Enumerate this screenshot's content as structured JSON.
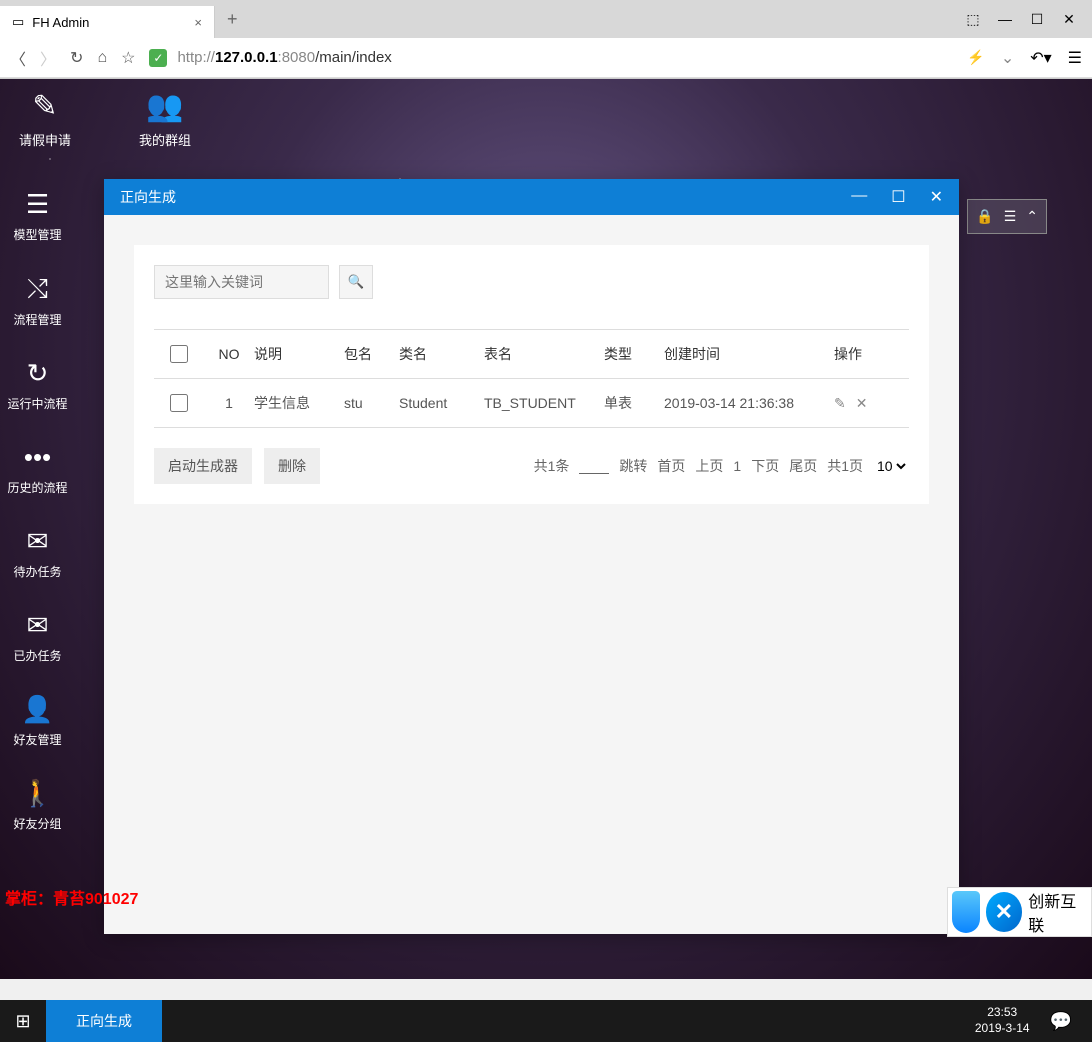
{
  "browser": {
    "tab_title": "FH Admin",
    "url_prefix": "http://",
    "url_host": "127.0.0.1",
    "url_port": ":8080",
    "url_path": "/main/index"
  },
  "top_icons": [
    {
      "label": "请假申请",
      "icon": "✎"
    },
    {
      "label": "我的群组",
      "icon": "👥"
    }
  ],
  "sidebar": [
    {
      "label": "模型管理",
      "icon": "☰"
    },
    {
      "label": "流程管理",
      "icon": "⤭"
    },
    {
      "label": "运行中流程",
      "icon": "↻"
    },
    {
      "label": "历史的流程",
      "icon": "•••"
    },
    {
      "label": "待办任务",
      "icon": "✉"
    },
    {
      "label": "已办任务",
      "icon": "✉"
    },
    {
      "label": "好友管理",
      "icon": "👤"
    },
    {
      "label": "好友分组",
      "icon": "🚶"
    }
  ],
  "modal": {
    "title": "正向生成",
    "search_placeholder": "这里输入关键词",
    "table": {
      "headers": [
        "NO",
        "说明",
        "包名",
        "类名",
        "表名",
        "类型",
        "创建时间",
        "操作"
      ],
      "rows": [
        {
          "no": "1",
          "desc": "学生信息",
          "pkg": "stu",
          "class": "Student",
          "table": "TB_STUDENT",
          "type": "单表",
          "time": "2019-03-14 21:36:38"
        }
      ],
      "footer_buttons": [
        "启动生成器",
        "删除"
      ],
      "pagination": {
        "total": "共1条",
        "jump": "跳转",
        "first": "首页",
        "prev": "上页",
        "current": "1",
        "next": "下页",
        "last": "尾页",
        "pages": "共1页",
        "pagesize": "10"
      }
    }
  },
  "watermark": "掌柜：青苔901027",
  "logo": {
    "text": "创新互联"
  },
  "taskbar": {
    "active_task": "正向生成",
    "time": "23:53",
    "date": "2019-3-14"
  }
}
